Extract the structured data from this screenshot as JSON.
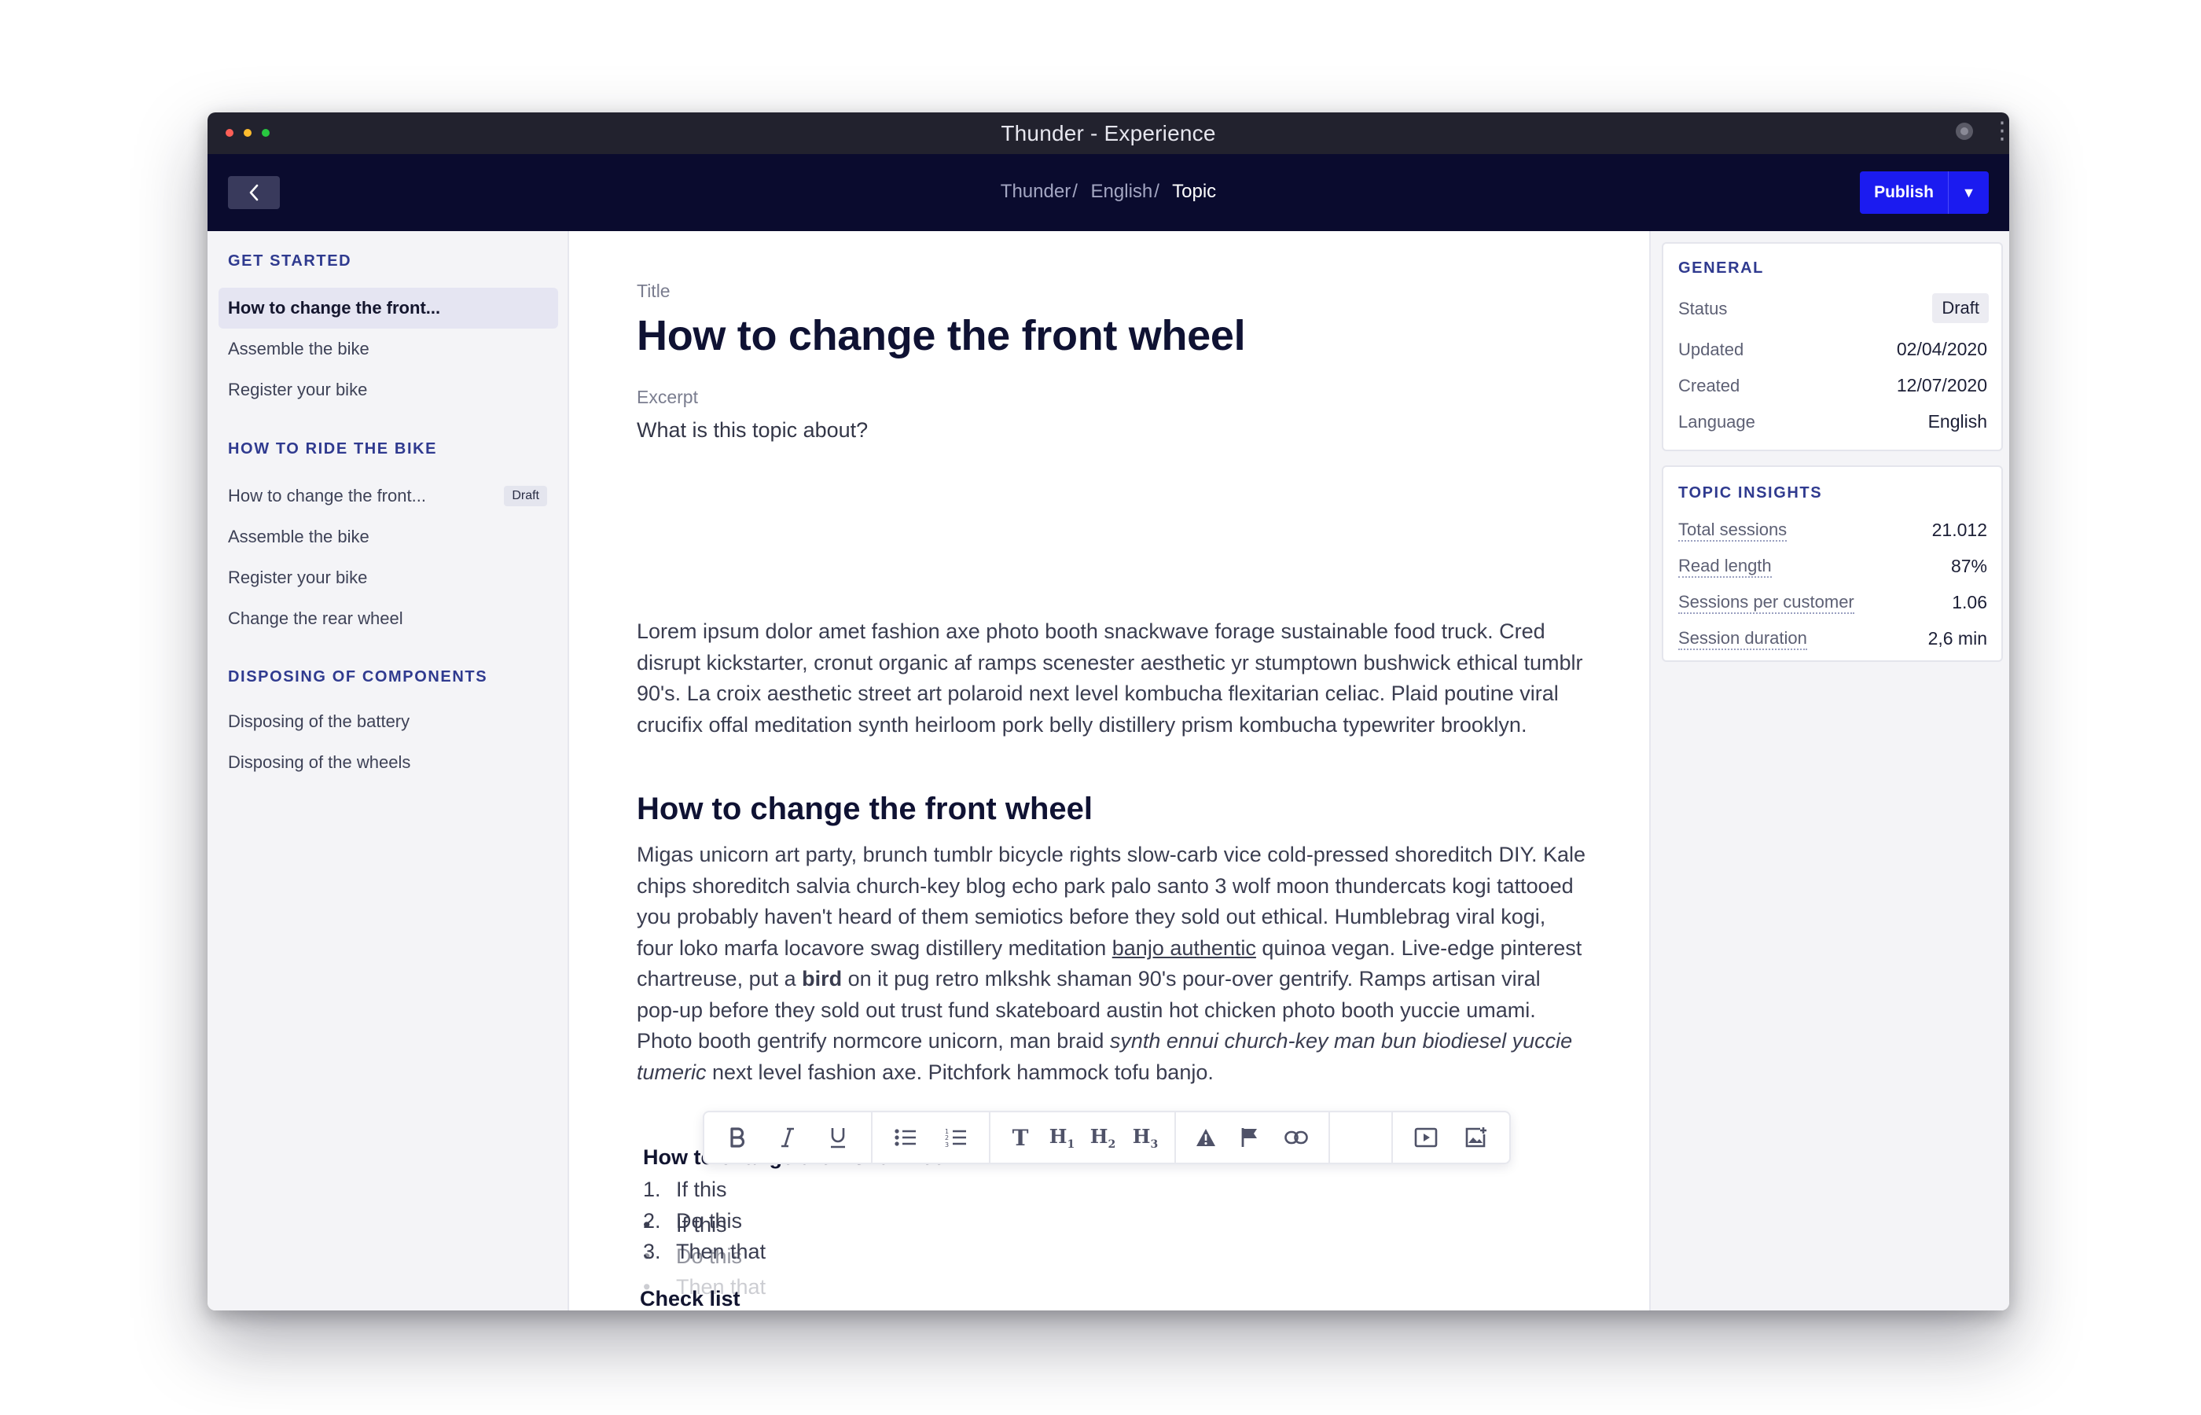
{
  "window": {
    "title": "Thunder - Experience"
  },
  "header": {
    "breadcrumb": [
      "Thunder",
      "English",
      "Topic"
    ],
    "breadcrumb_sep": "/",
    "publish_label": "Publish",
    "publish_caret": "▼"
  },
  "sidebar": {
    "sections": [
      {
        "title": "GET STARTED",
        "items": [
          {
            "label": "How to change the front...",
            "active": true
          },
          {
            "label": "Assemble the bike"
          },
          {
            "label": "Register your bike"
          }
        ]
      },
      {
        "title": "HOW TO RIDE THE BIKE",
        "items": [
          {
            "label": "How to change the front...",
            "badge": "Draft"
          },
          {
            "label": "Assemble the bike"
          },
          {
            "label": "Register your bike"
          },
          {
            "label": "Change the rear wheel"
          }
        ]
      },
      {
        "title": "DISPOSING OF COMPONENTS",
        "items": [
          {
            "label": "Disposing of the battery"
          },
          {
            "label": "Disposing of the wheels"
          }
        ]
      }
    ]
  },
  "editor": {
    "title_label": "Title",
    "title": "How to change the front wheel",
    "excerpt_label": "Excerpt",
    "excerpt_placeholder": "What is this topic about?",
    "paragraph1": "Lorem ipsum dolor amet fashion axe photo booth snackwave forage sustainable food truck. Cred disrupt kickstarter, cronut organic af ramps scenester aesthetic yr stumptown bushwick ethical tumblr 90's. La croix aesthetic street art polaroid next level kombucha flexitarian celiac. Plaid poutine viral crucifix offal meditation synth heirloom pork belly distillery prism kombucha typewriter brooklyn.",
    "heading2": "How to change the front wheel",
    "paragraph2": {
      "part1": "Migas unicorn art party, brunch tumblr bicycle rights slow-carb vice cold-pressed shoreditch DIY. Kale chips shoreditch salvia church-key blog echo park palo santo 3 wolf moon thundercats kogi tattooed you probably haven't heard of them semiotics before they sold out ethical. Humblebrag viral kogi, four loko marfa locavore swag distillery meditation ",
      "link": "banjo authentic",
      "part2": " quinoa vegan. Live-edge pinterest chartreuse, put a ",
      "bold": "bird",
      "part3": " on it pug retro mlkshk shaman 90's pour-over gentrify. Ramps artisan viral pop-up before they sold out trust fund skateboard austin hot chicken photo booth yuccie umami. Photo booth gentrify normcore unicorn, man braid ",
      "italic": "synth ennui church-key man bun biodiesel yuccie tumeric",
      "part4": " next level fashion axe. Pitchfork hammock tofu banjo."
    },
    "ordered_heading": "How to change the front wheel",
    "ordered_list": [
      {
        "num": "1.",
        "text": "If this"
      },
      {
        "num": "2.",
        "text": "Do this"
      },
      {
        "num": "3.",
        "text": "Then that"
      }
    ],
    "checklist_heading": "Check list",
    "checklist": [
      {
        "bullet": "•",
        "text": "If this"
      },
      {
        "bullet": "•",
        "text": "Do this"
      },
      {
        "bullet": "•",
        "text": "Then that"
      }
    ]
  },
  "toolbar": {
    "icons": [
      "bold-icon",
      "italic-icon",
      "underline-icon",
      "bullet-list-icon",
      "numbered-list-icon",
      "text-icon",
      "heading1-icon",
      "heading2-icon",
      "heading3-icon",
      "warning-icon",
      "flag-icon",
      "link-icon",
      "video-icon",
      "image-icon"
    ],
    "text_label": "T",
    "h1_label": "H",
    "h1_sub": "1",
    "h2_sub": "2",
    "h3_sub": "3"
  },
  "general": {
    "title": "GENERAL",
    "status_label": "Status",
    "status_value": "Draft",
    "updated_label": "Updated",
    "updated_value": "02/04/2020",
    "created_label": "Created",
    "created_value": "12/07/2020",
    "language_label": "Language",
    "language_value": "English"
  },
  "insights": {
    "title": "TOPIC INSIGHTS",
    "rows": [
      {
        "label": "Total sessions",
        "value": "21.012"
      },
      {
        "label": "Read length",
        "value": "87%"
      },
      {
        "label": "Sessions per customer",
        "value": "1.06"
      },
      {
        "label": "Session duration",
        "value": "2,6 min"
      }
    ]
  },
  "colors": {
    "accent": "#1b1bf0",
    "header_bg": "#0a0b2e",
    "section_title": "#2f3a8f"
  }
}
